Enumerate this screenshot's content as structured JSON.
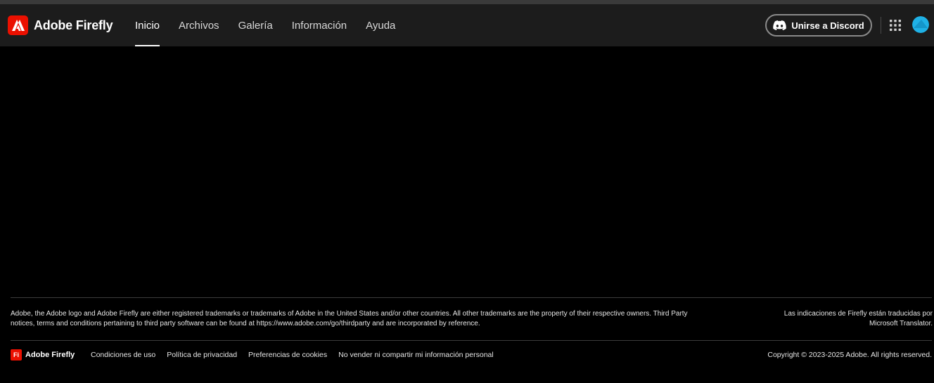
{
  "header": {
    "brand_name": "Adobe Firefly",
    "nav": [
      {
        "label": "Inicio",
        "active": true
      },
      {
        "label": "Archivos",
        "active": false
      },
      {
        "label": "Galería",
        "active": false
      },
      {
        "label": "Información",
        "active": false
      },
      {
        "label": "Ayuda",
        "active": false
      }
    ],
    "discord_button": "Unirse a Discord",
    "icons": {
      "logo": "adobe-logo-icon",
      "discord": "discord-icon",
      "apps": "app-grid-icon",
      "avatar": "user-avatar"
    }
  },
  "footer": {
    "legal_text": "Adobe, the Adobe logo and Adobe Firefly are either registered trademarks or trademarks of Adobe in the United States and/or other countries. All other trademarks are the property of their respective owners. Third Party notices, terms and conditions pertaining to third party software can be found at https://www.adobe.com/go/thirdparty and are incorporated by reference.",
    "translator_text": "Las indicaciones de Firefly están traducidas por Microsoft Translator.",
    "brand_badge": "Fi",
    "brand_name": "Adobe Firefly",
    "links": [
      "Condiciones de uso",
      "Política de privacidad",
      "Preferencias de cookies",
      "No vender ni compartir mi información personal"
    ],
    "copyright": "Copyright © 2023-2025 Adobe. All rights reserved."
  },
  "colors": {
    "brand_red": "#eb1000",
    "header_bg": "#1c1c1c",
    "page_bg": "#000000",
    "avatar": "#1fb1e6"
  }
}
